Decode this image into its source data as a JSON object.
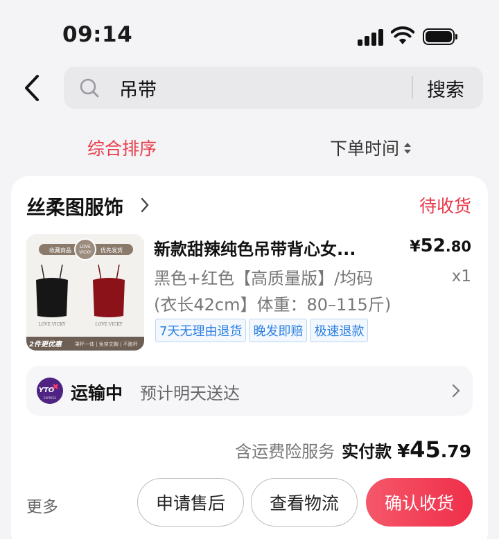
{
  "status_bar": {
    "time": "09:14"
  },
  "search": {
    "query": "吊带",
    "button_label": "搜索"
  },
  "sort": {
    "comprehensive": "综合排序",
    "order_time": "下单时间"
  },
  "order": {
    "shop_name": "丝柔图服饰",
    "status": "待收货",
    "product": {
      "title": "新款甜辣纯色吊带背心女...",
      "price_currency": "¥",
      "price_int": "52",
      "price_dec": ".80",
      "quantity": "x1",
      "spec_line1": "黑色+红色【高质量版】/均码",
      "spec_line2": "(衣长42cm】体重：80–115斤)",
      "tags": [
        "7天无理由退货",
        "晚发即赔",
        "极速退款"
      ],
      "image_text": {
        "badge_left": "收藏商品",
        "badge_right": "优先发货",
        "brand_top": "LOVE",
        "brand_bottom": "VICKY",
        "caption_left": "LOVE VICKY",
        "caption_right": "LOVE VICKY",
        "banner_left": "2件更优惠",
        "banner_right": "罩杯一体 | 免穿文胸 | 不跑杯"
      }
    },
    "logistics": {
      "carrier_logo_text": "YTO",
      "carrier_logo_sub": "EXPRESS",
      "status": "运输中",
      "eta": "预计明天送达"
    },
    "summary": {
      "insurance": "含运费险服务",
      "paid_label": "实付款",
      "currency": "¥",
      "amount_int": "45",
      "amount_dec": ".79"
    },
    "actions": {
      "more": "更多",
      "after_sale": "申请售后",
      "track": "查看物流",
      "confirm": "确认收货"
    }
  },
  "colors": {
    "accent": "#e8384a",
    "tag_blue": "#2b7fe0",
    "background": "#f4f4f6"
  }
}
